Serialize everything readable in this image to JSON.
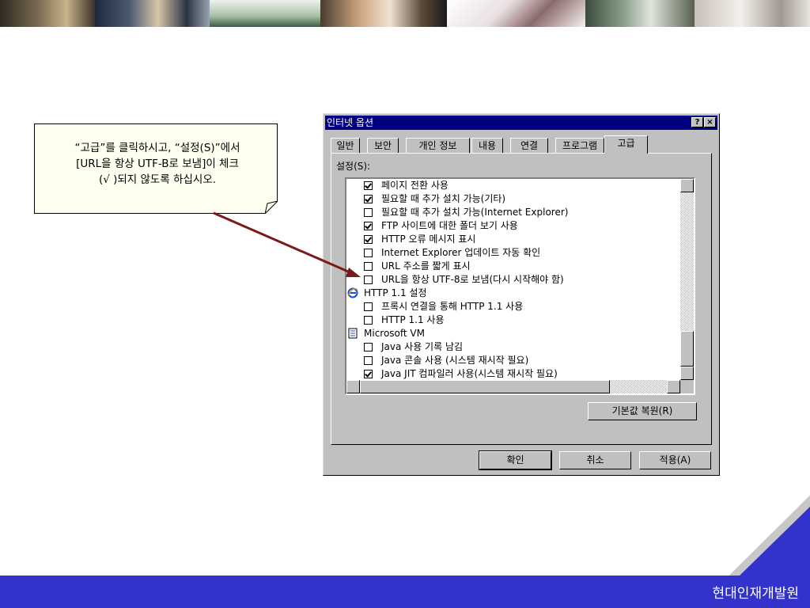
{
  "callout": {
    "line1": "“고급”를 클릭하시고, “설정(S)”에서",
    "line2": "[URL을 항상 UTF-B로 보냄]이 체크",
    "line3": "(√ )되지 않도록 하십시오."
  },
  "dialog": {
    "title": "인터넷 옵션",
    "help_label": "?",
    "close_label": "×",
    "tabs": [
      "일반",
      "보안",
      "개인 정보",
      "내용",
      "연결",
      "프로그램",
      "고급"
    ],
    "active_tab": "고급",
    "settings_label": "설정(S):",
    "items": [
      {
        "type": "checkbox",
        "label": "페이지 전환 사용",
        "checked": true
      },
      {
        "type": "checkbox",
        "label": "필요할 때 추가 설치 가능(기타)",
        "checked": true
      },
      {
        "type": "checkbox",
        "label": "필요할 때 추가 설치 가능(Internet Explorer)",
        "checked": false
      },
      {
        "type": "checkbox",
        "label": "FTP 사이트에 대한 폴더 보기 사용",
        "checked": true
      },
      {
        "type": "checkbox",
        "label": "HTTP 오류 메시지 표시",
        "checked": true
      },
      {
        "type": "checkbox",
        "label": "Internet Explorer 업데이트 자동 확인",
        "checked": false
      },
      {
        "type": "checkbox",
        "label": "URL 주소를 짧게 표시",
        "checked": false
      },
      {
        "type": "checkbox",
        "label": "URL을 항상 UTF-8로 보냄(다시 시작해야 함)",
        "checked": false
      },
      {
        "type": "category",
        "label": "HTTP 1.1 설정",
        "icon": "ie-icon"
      },
      {
        "type": "checkbox",
        "label": "프록시 연결을 통해 HTTP 1.1 사용",
        "checked": false
      },
      {
        "type": "checkbox",
        "label": "HTTP 1.1 사용",
        "checked": false
      },
      {
        "type": "category",
        "label": "Microsoft VM",
        "icon": "document-icon"
      },
      {
        "type": "checkbox",
        "label": "Java 사용 기록 남김",
        "checked": false
      },
      {
        "type": "checkbox",
        "label": "Java 콘솔 사용 (시스템 재시작 필요)",
        "checked": false
      },
      {
        "type": "checkbox",
        "label": "Java JIT 컴파일러 사용(시스템 재시작 필요)",
        "checked": true
      }
    ],
    "restore_defaults_label": "기본값 복원(R)",
    "ok_label": "확인",
    "cancel_label": "취소",
    "apply_label": "적용(A)"
  },
  "footer": {
    "org_name": "현대인재개발원",
    "bar_color": "#3333cc",
    "triangle_color": "#3333cc"
  }
}
